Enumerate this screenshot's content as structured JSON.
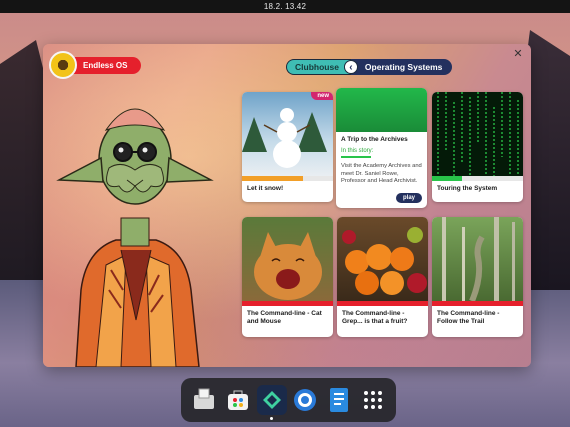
{
  "topbar": {
    "datetime": "18.2.  13.42"
  },
  "user": {
    "name": "Endless OS"
  },
  "breadcrumb": {
    "root": "Clubhouse",
    "separator_icon": "chevron-left-icon",
    "current": "Operating Systems"
  },
  "window": {
    "close_icon": "close-icon"
  },
  "cards": [
    {
      "title": "Let it snow!",
      "badge": "new",
      "thumb": "snowman"
    },
    {
      "title": "A Trip to the Archives",
      "subtitle": "In this story:",
      "description": "Visit the Academy Archives and meet Dr. Saniel Rowe, Professor and Head Archivist.",
      "button": "play",
      "thumb": "archives"
    },
    {
      "title": "Touring the System",
      "thumb": "matrix"
    },
    {
      "title": "The Command-line - Cat and Mouse",
      "thumb": "cat"
    },
    {
      "title": "The Command-line - Grep... is that a fruit?",
      "thumb": "fruit"
    },
    {
      "title": "The Command-line - Follow the Trail",
      "thumb": "forest"
    }
  ],
  "dock": [
    {
      "name": "files-app-icon",
      "running": false
    },
    {
      "name": "app-center-icon",
      "running": false
    },
    {
      "name": "clubhouse-icon",
      "running": true
    },
    {
      "name": "browser-icon",
      "running": false
    },
    {
      "name": "documents-icon",
      "running": false
    },
    {
      "name": "app-grid-icon",
      "running": false
    }
  ],
  "colors": {
    "accent_red": "#e5202c",
    "accent_navy": "#23305e",
    "accent_teal": "#3fbdb4",
    "badge_pink": "#d3266e",
    "story_green": "#2aa83a"
  }
}
